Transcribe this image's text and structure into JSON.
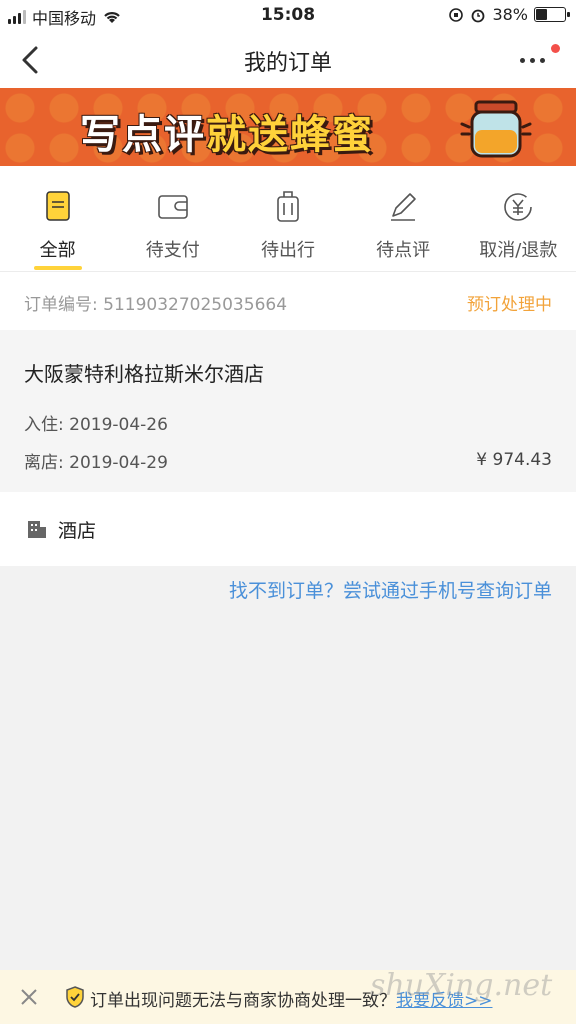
{
  "status_bar": {
    "carrier": "中国移动",
    "time": "15:08",
    "battery": "38%"
  },
  "nav": {
    "title": "我的订单"
  },
  "banner": {
    "text_part1": "写点评",
    "text_part2": "就送蜂蜜"
  },
  "tabs": [
    {
      "label": "全部",
      "icon": "all-orders-icon",
      "active": true
    },
    {
      "label": "待支付",
      "icon": "wallet-icon",
      "active": false
    },
    {
      "label": "待出行",
      "icon": "luggage-icon",
      "active": false
    },
    {
      "label": "待点评",
      "icon": "pen-icon",
      "active": false
    },
    {
      "label": "取消/退款",
      "icon": "refund-yen-icon",
      "active": false
    }
  ],
  "order": {
    "number_label": "订单编号:",
    "number": "51190327025035664",
    "status": "预订处理中",
    "hotel_name": "大阪蒙特利格拉斯米尔酒店",
    "checkin_label": "入住:",
    "checkin": "2019-04-26",
    "checkout_label": "离店:",
    "checkout": "2019-04-29",
    "price": "¥ 974.43",
    "category": "酒店"
  },
  "find_link": "找不到订单？尝试通过手机号查询订单",
  "bottom_bar": {
    "notice": "订单出现问题无法与商家协商处理一致？",
    "link": "我要反馈>>"
  },
  "watermark": "shuXing.net",
  "colors": {
    "accent": "#ffd33a",
    "status": "#f2a33a",
    "link": "#4a90d9",
    "banner": "#e8632d"
  }
}
